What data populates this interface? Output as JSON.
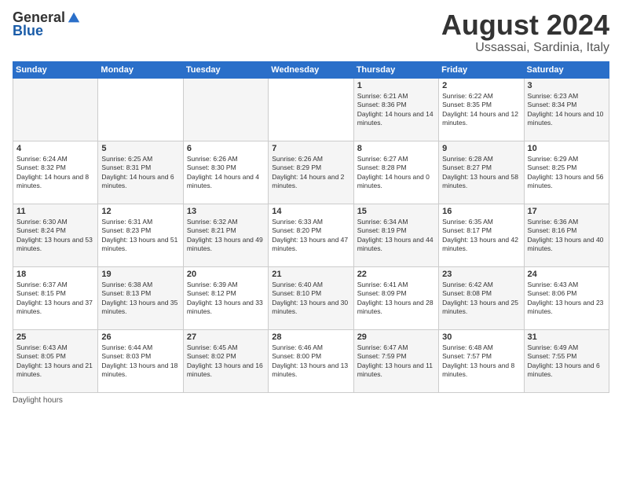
{
  "header": {
    "logo_general": "General",
    "logo_blue": "Blue",
    "month": "August 2024",
    "location": "Ussassai, Sardinia, Italy"
  },
  "weekdays": [
    "Sunday",
    "Monday",
    "Tuesday",
    "Wednesday",
    "Thursday",
    "Friday",
    "Saturday"
  ],
  "weeks": [
    [
      {
        "day": "",
        "info": ""
      },
      {
        "day": "",
        "info": ""
      },
      {
        "day": "",
        "info": ""
      },
      {
        "day": "",
        "info": ""
      },
      {
        "day": "1",
        "info": "Sunrise: 6:21 AM\nSunset: 8:36 PM\nDaylight: 14 hours and 14 minutes."
      },
      {
        "day": "2",
        "info": "Sunrise: 6:22 AM\nSunset: 8:35 PM\nDaylight: 14 hours and 12 minutes."
      },
      {
        "day": "3",
        "info": "Sunrise: 6:23 AM\nSunset: 8:34 PM\nDaylight: 14 hours and 10 minutes."
      }
    ],
    [
      {
        "day": "4",
        "info": "Sunrise: 6:24 AM\nSunset: 8:32 PM\nDaylight: 14 hours and 8 minutes."
      },
      {
        "day": "5",
        "info": "Sunrise: 6:25 AM\nSunset: 8:31 PM\nDaylight: 14 hours and 6 minutes."
      },
      {
        "day": "6",
        "info": "Sunrise: 6:26 AM\nSunset: 8:30 PM\nDaylight: 14 hours and 4 minutes."
      },
      {
        "day": "7",
        "info": "Sunrise: 6:26 AM\nSunset: 8:29 PM\nDaylight: 14 hours and 2 minutes."
      },
      {
        "day": "8",
        "info": "Sunrise: 6:27 AM\nSunset: 8:28 PM\nDaylight: 14 hours and 0 minutes."
      },
      {
        "day": "9",
        "info": "Sunrise: 6:28 AM\nSunset: 8:27 PM\nDaylight: 13 hours and 58 minutes."
      },
      {
        "day": "10",
        "info": "Sunrise: 6:29 AM\nSunset: 8:25 PM\nDaylight: 13 hours and 56 minutes."
      }
    ],
    [
      {
        "day": "11",
        "info": "Sunrise: 6:30 AM\nSunset: 8:24 PM\nDaylight: 13 hours and 53 minutes."
      },
      {
        "day": "12",
        "info": "Sunrise: 6:31 AM\nSunset: 8:23 PM\nDaylight: 13 hours and 51 minutes."
      },
      {
        "day": "13",
        "info": "Sunrise: 6:32 AM\nSunset: 8:21 PM\nDaylight: 13 hours and 49 minutes."
      },
      {
        "day": "14",
        "info": "Sunrise: 6:33 AM\nSunset: 8:20 PM\nDaylight: 13 hours and 47 minutes."
      },
      {
        "day": "15",
        "info": "Sunrise: 6:34 AM\nSunset: 8:19 PM\nDaylight: 13 hours and 44 minutes."
      },
      {
        "day": "16",
        "info": "Sunrise: 6:35 AM\nSunset: 8:17 PM\nDaylight: 13 hours and 42 minutes."
      },
      {
        "day": "17",
        "info": "Sunrise: 6:36 AM\nSunset: 8:16 PM\nDaylight: 13 hours and 40 minutes."
      }
    ],
    [
      {
        "day": "18",
        "info": "Sunrise: 6:37 AM\nSunset: 8:15 PM\nDaylight: 13 hours and 37 minutes."
      },
      {
        "day": "19",
        "info": "Sunrise: 6:38 AM\nSunset: 8:13 PM\nDaylight: 13 hours and 35 minutes."
      },
      {
        "day": "20",
        "info": "Sunrise: 6:39 AM\nSunset: 8:12 PM\nDaylight: 13 hours and 33 minutes."
      },
      {
        "day": "21",
        "info": "Sunrise: 6:40 AM\nSunset: 8:10 PM\nDaylight: 13 hours and 30 minutes."
      },
      {
        "day": "22",
        "info": "Sunrise: 6:41 AM\nSunset: 8:09 PM\nDaylight: 13 hours and 28 minutes."
      },
      {
        "day": "23",
        "info": "Sunrise: 6:42 AM\nSunset: 8:08 PM\nDaylight: 13 hours and 25 minutes."
      },
      {
        "day": "24",
        "info": "Sunrise: 6:43 AM\nSunset: 8:06 PM\nDaylight: 13 hours and 23 minutes."
      }
    ],
    [
      {
        "day": "25",
        "info": "Sunrise: 6:43 AM\nSunset: 8:05 PM\nDaylight: 13 hours and 21 minutes."
      },
      {
        "day": "26",
        "info": "Sunrise: 6:44 AM\nSunset: 8:03 PM\nDaylight: 13 hours and 18 minutes."
      },
      {
        "day": "27",
        "info": "Sunrise: 6:45 AM\nSunset: 8:02 PM\nDaylight: 13 hours and 16 minutes."
      },
      {
        "day": "28",
        "info": "Sunrise: 6:46 AM\nSunset: 8:00 PM\nDaylight: 13 hours and 13 minutes."
      },
      {
        "day": "29",
        "info": "Sunrise: 6:47 AM\nSunset: 7:59 PM\nDaylight: 13 hours and 11 minutes."
      },
      {
        "day": "30",
        "info": "Sunrise: 6:48 AM\nSunset: 7:57 PM\nDaylight: 13 hours and 8 minutes."
      },
      {
        "day": "31",
        "info": "Sunrise: 6:49 AM\nSunset: 7:55 PM\nDaylight: 13 hours and 6 minutes."
      }
    ]
  ],
  "footer": {
    "daylight_label": "Daylight hours"
  }
}
